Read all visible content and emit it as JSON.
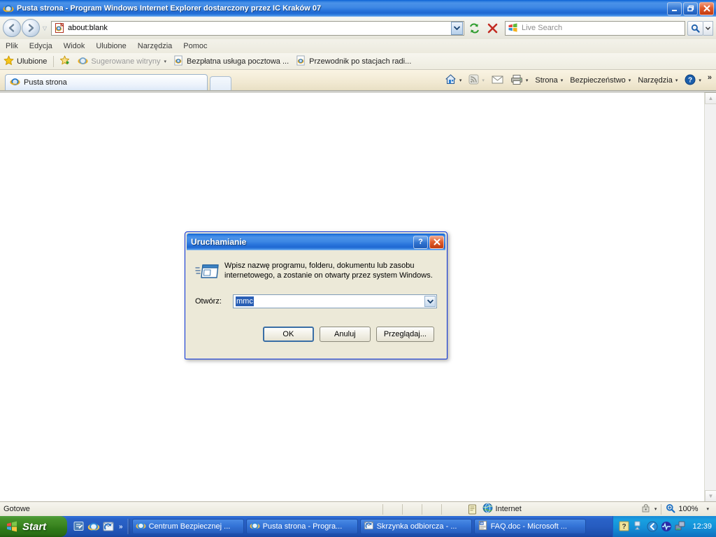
{
  "window": {
    "title": "Pusta strona - Program Windows Internet Explorer dostarczony przez IC Kraków 07",
    "icon": "ie-icon",
    "minimize_label": "_",
    "maximize_label": "❐",
    "close_label": "✕"
  },
  "navigation": {
    "back_label": "◀",
    "forward_label": "▶",
    "recent_caret": "▽",
    "address": {
      "icon": "page-icon",
      "value": "about:blank",
      "dropdown_caret": "▾"
    },
    "refresh_label": "↻",
    "stop_label": "✕"
  },
  "search": {
    "icon": "windows-logo-icon",
    "placeholder": "Live Search",
    "value": "",
    "go_label": "⌕",
    "caret": "▾"
  },
  "menu": {
    "items": [
      {
        "label": "Plik"
      },
      {
        "label": "Edycja"
      },
      {
        "label": "Widok"
      },
      {
        "label": "Ulubione"
      },
      {
        "label": "Narzędzia"
      },
      {
        "label": "Pomoc"
      }
    ]
  },
  "favorites_bar": {
    "favorites_label": "Ulubione",
    "add_label": "",
    "suggested_label": "Sugerowane witryny",
    "suggested_caret": "▾",
    "links": [
      {
        "label": "Bezpłatna usługa pocztowa ..."
      },
      {
        "label": "Przewodnik po stacjach radi..."
      }
    ]
  },
  "tabs": {
    "items": [
      {
        "label": "Pusta strona",
        "active": true
      }
    ],
    "new_tab_label": ""
  },
  "command_bar": {
    "home_label": "",
    "home_caret": "▾",
    "feeds_label": "",
    "feeds_caret": "▾",
    "mail_label": "",
    "print_label": "",
    "print_caret": "▾",
    "page_label": "Strona",
    "page_caret": "▾",
    "safety_label": "Bezpieczeństwo",
    "safety_caret": "▾",
    "tools_label": "Narzędzia",
    "tools_caret": "▾",
    "help_caret": "▾",
    "overflow_label": "»"
  },
  "page_area": {
    "content": "",
    "scroll_up": "▲",
    "scroll_down": "▼"
  },
  "dialog": {
    "title": "Uruchamianie",
    "help_label": "?",
    "close_label": "✕",
    "icon": "run-window-icon",
    "message": "Wpisz nazwę programu, folderu, dokumentu lub zasobu internetowego, a zostanie on otwarty przez system Windows.",
    "open_label": "Otwórz:",
    "open_value": "mmc",
    "open_caret": "▾",
    "buttons": [
      {
        "label": "OK",
        "default": true
      },
      {
        "label": "Anuluj",
        "default": false
      },
      {
        "label": "Przeglądaj...",
        "default": false
      }
    ]
  },
  "status_bar": {
    "status_text": "Gotowe",
    "zone_icon": "globe-icon",
    "zone_label": "Internet",
    "protected_icon": "lock-icon",
    "protected_caret": "▾",
    "zoom_icon": "magnifier-icon",
    "zoom_label": "100%",
    "zoom_caret": "▾"
  },
  "taskbar": {
    "start_label": "Start",
    "quick_launch": [
      {
        "icon": "show-desktop-icon"
      },
      {
        "icon": "ie-icon"
      },
      {
        "icon": "outlook-icon"
      }
    ],
    "quick_launch_overflow": "»",
    "items": [
      {
        "label": "Centrum Bezpiecznej ...",
        "icon": "ie-icon"
      },
      {
        "label": "Pusta strona - Progra...",
        "icon": "ie-icon"
      },
      {
        "label": "Skrzynka odbiorcza - ...",
        "icon": "outlook-icon"
      },
      {
        "label": "FAQ.doc - Microsoft ...",
        "icon": "word-icon"
      }
    ],
    "tray": [
      {
        "icon": "help-tray-icon"
      },
      {
        "icon": "updates-tray-icon"
      },
      {
        "icon": "shield-tray-icon"
      },
      {
        "icon": "sound-tray-icon"
      },
      {
        "icon": "network-tray-icon"
      }
    ],
    "clock": "12:39"
  },
  "colors": {
    "titlebar_blue": "#2f7ee0",
    "taskbar_blue": "#265cc0",
    "start_green": "#3d8722",
    "dialog_face": "#ece9d8",
    "selection_blue": "#2a5fb5",
    "close_red": "#e05a2b"
  }
}
